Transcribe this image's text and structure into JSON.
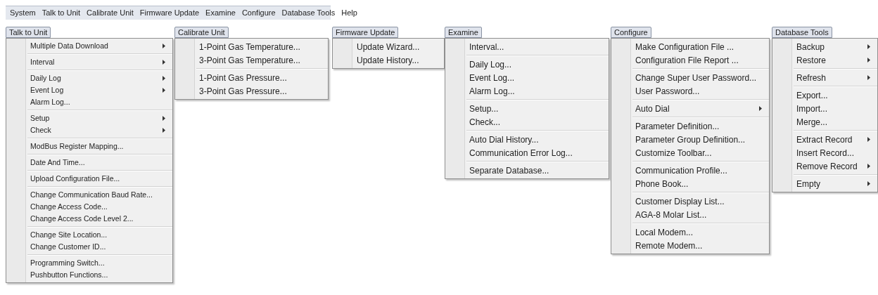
{
  "menu_bar": [
    "System",
    "Talk to Unit",
    "Calibrate Unit",
    "Firmware Update",
    "Examine",
    "Configure",
    "Database Tools",
    "Help"
  ],
  "menus": [
    {
      "title": "Talk to Unit",
      "groups": [
        [
          {
            "label": "Multiple Data Download",
            "submenu": true
          }
        ],
        [
          {
            "label": "Interval",
            "submenu": true
          }
        ],
        [
          {
            "label": "Daily Log",
            "submenu": true
          },
          {
            "label": "Event Log",
            "submenu": true
          },
          {
            "label": "Alarm Log...",
            "submenu": false
          }
        ],
        [
          {
            "label": "Setup",
            "submenu": true
          },
          {
            "label": "Check",
            "submenu": true
          }
        ],
        [
          {
            "label": "ModBus Register Mapping...",
            "submenu": false
          }
        ],
        [
          {
            "label": "Date And Time...",
            "submenu": false
          }
        ],
        [
          {
            "label": "Upload Configuration File...",
            "submenu": false
          }
        ],
        [
          {
            "label": "Change Communication Baud Rate...",
            "submenu": false
          },
          {
            "label": "Change Access Code...",
            "submenu": false
          },
          {
            "label": "Change Access Code Level 2...",
            "submenu": false
          }
        ],
        [
          {
            "label": "Change Site Location...",
            "submenu": false
          },
          {
            "label": "Change Customer ID...",
            "submenu": false
          }
        ],
        [
          {
            "label": "Programming Switch...",
            "submenu": false
          },
          {
            "label": "Pushbutton Functions...",
            "submenu": false
          }
        ]
      ]
    },
    {
      "title": "Calibrate Unit",
      "groups": [
        [
          {
            "label": "1-Point Gas Temperature...",
            "submenu": false
          },
          {
            "label": "3-Point Gas Temperature...",
            "submenu": false
          }
        ],
        [
          {
            "label": "1-Point Gas Pressure...",
            "submenu": false
          },
          {
            "label": "3-Point Gas Pressure...",
            "submenu": false
          }
        ]
      ]
    },
    {
      "title": "Firmware Update",
      "groups": [
        [
          {
            "label": "Update Wizard...",
            "submenu": false
          },
          {
            "label": "Update History...",
            "submenu": false
          }
        ]
      ]
    },
    {
      "title": "Examine",
      "groups": [
        [
          {
            "label": "Interval...",
            "submenu": false
          }
        ],
        [
          {
            "label": "Daily Log...",
            "submenu": false
          },
          {
            "label": "Event Log...",
            "submenu": false
          },
          {
            "label": "Alarm Log...",
            "submenu": false
          }
        ],
        [
          {
            "label": "Setup...",
            "submenu": false
          },
          {
            "label": "Check...",
            "submenu": false
          }
        ],
        [
          {
            "label": "Auto Dial History...",
            "submenu": false
          },
          {
            "label": "Communication Error Log...",
            "submenu": false
          }
        ],
        [
          {
            "label": "Separate Database...",
            "submenu": false
          }
        ]
      ]
    },
    {
      "title": "Configure",
      "groups": [
        [
          {
            "label": "Make Configuration File ...",
            "submenu": false
          },
          {
            "label": "Configuration File Report ...",
            "submenu": false
          }
        ],
        [
          {
            "label": "Change Super User Password...",
            "submenu": false
          },
          {
            "label": "User Password...",
            "submenu": false
          }
        ],
        [
          {
            "label": "Auto Dial",
            "submenu": true
          }
        ],
        [
          {
            "label": "Parameter Definition...",
            "submenu": false
          },
          {
            "label": "Parameter Group Definition...",
            "submenu": false
          },
          {
            "label": "Customize Toolbar...",
            "submenu": false
          }
        ],
        [
          {
            "label": "Communication Profile...",
            "submenu": false
          },
          {
            "label": "Phone Book...",
            "submenu": false
          }
        ],
        [
          {
            "label": "Customer Display List...",
            "submenu": false
          },
          {
            "label": "AGA-8 Molar List...",
            "submenu": false
          }
        ],
        [
          {
            "label": "Local Modem...",
            "submenu": false
          },
          {
            "label": "Remote Modem...",
            "submenu": false
          }
        ]
      ]
    },
    {
      "title": "Database Tools",
      "groups": [
        [
          {
            "label": "Backup",
            "submenu": true
          },
          {
            "label": "Restore",
            "submenu": true
          }
        ],
        [
          {
            "label": "Refresh",
            "submenu": true
          }
        ],
        [
          {
            "label": "Export...",
            "submenu": false
          },
          {
            "label": "Import...",
            "submenu": false
          },
          {
            "label": "Merge...",
            "submenu": false
          }
        ],
        [
          {
            "label": "Extract Record",
            "submenu": true
          },
          {
            "label": "Insert Record...",
            "submenu": false
          },
          {
            "label": "Remove Record",
            "submenu": true
          }
        ],
        [
          {
            "label": "Empty",
            "submenu": true
          }
        ]
      ]
    }
  ]
}
